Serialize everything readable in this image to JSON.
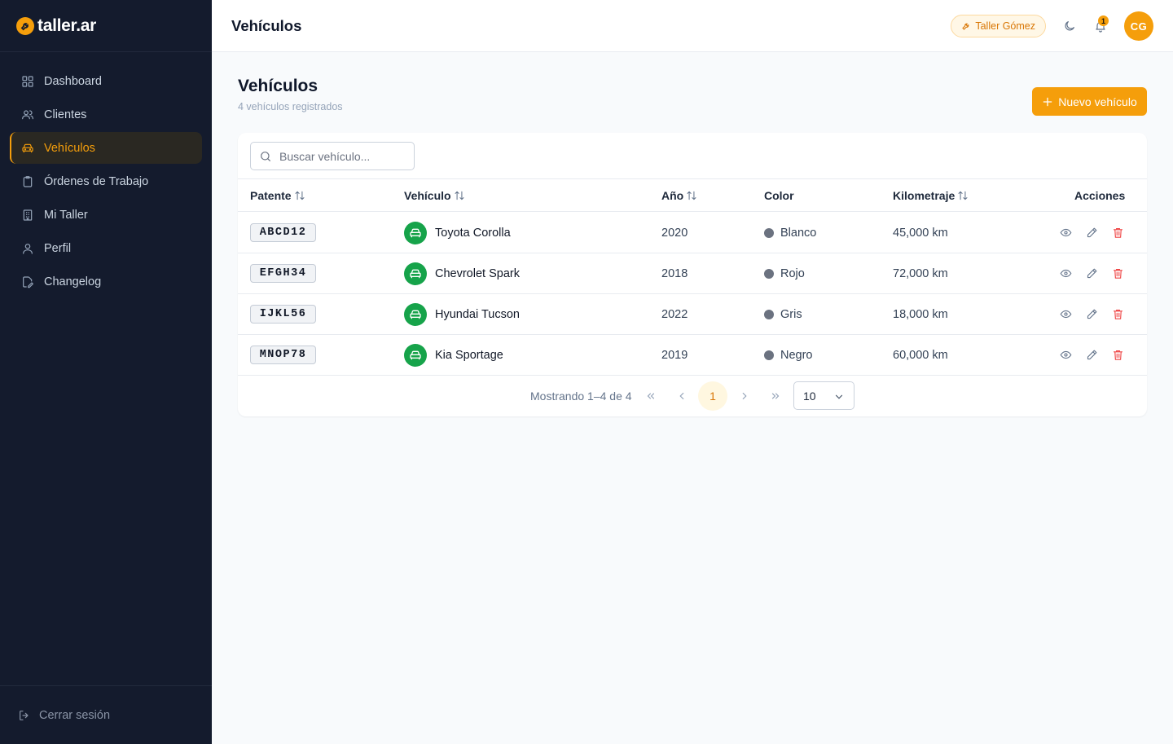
{
  "app": {
    "logo": "taller.ar"
  },
  "sidebar": {
    "items": [
      {
        "label": "Dashboard",
        "icon": "grid-icon"
      },
      {
        "label": "Clientes",
        "icon": "users-icon"
      },
      {
        "label": "Vehículos",
        "icon": "car-icon",
        "active": true
      },
      {
        "label": "Órdenes de Trabajo",
        "icon": "clipboard-icon"
      },
      {
        "label": "Mi Taller",
        "icon": "building-icon"
      },
      {
        "label": "Perfil",
        "icon": "user-icon"
      },
      {
        "label": "Changelog",
        "icon": "file-edit-icon"
      }
    ],
    "logout": "Cerrar sesión"
  },
  "header": {
    "title": "Vehículos",
    "shop": "Taller Gómez",
    "notifications": "1",
    "avatar": "CG"
  },
  "page": {
    "title": "Vehículos",
    "subtitle": "4 vehículos registrados",
    "new_button": "Nuevo vehículo"
  },
  "search": {
    "placeholder": "Buscar vehículo..."
  },
  "table": {
    "columns": [
      "Patente",
      "Vehículo",
      "Año",
      "Color",
      "Kilometraje",
      "Acciones"
    ],
    "rows": [
      {
        "plate": "ABCD12",
        "vehicle": "Toyota Corolla",
        "year": "2020",
        "color": "Blanco",
        "km": "45,000 km"
      },
      {
        "plate": "EFGH34",
        "vehicle": "Chevrolet Spark",
        "year": "2018",
        "color": "Rojo",
        "km": "72,000 km"
      },
      {
        "plate": "IJKL56",
        "vehicle": "Hyundai Tucson",
        "year": "2022",
        "color": "Gris",
        "km": "18,000 km"
      },
      {
        "plate": "MNOP78",
        "vehicle": "Kia Sportage",
        "year": "2019",
        "color": "Negro",
        "km": "60,000 km"
      }
    ]
  },
  "pagination": {
    "info": "Mostrando 1–4 de 4",
    "current_page": "1",
    "page_size": "10"
  },
  "colors": {
    "accent": "#f59e0b",
    "sidebar_bg": "#141b2d",
    "vehicle_icon_bg": "#16a34a",
    "danger": "#ef4444"
  }
}
